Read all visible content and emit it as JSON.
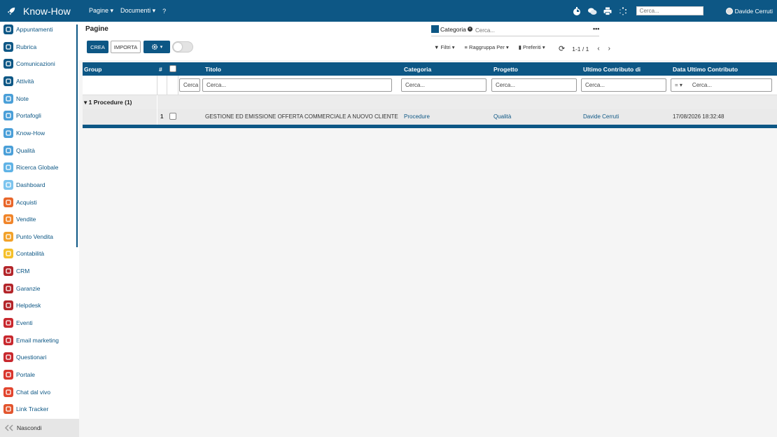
{
  "app": {
    "title": "Know-How"
  },
  "topmenu": [
    {
      "label": "Pagine ▾"
    },
    {
      "label": "Documenti ▾"
    },
    {
      "label": "?"
    }
  ],
  "top_search": {
    "placeholder": "Cerca..."
  },
  "user": {
    "name": "Davide Cerruti"
  },
  "sidebar": {
    "items": [
      {
        "label": "Appuntamenti",
        "color": "#0d5785",
        "icon": "calendar-icon"
      },
      {
        "label": "Rubrica",
        "color": "#0d5785",
        "icon": "address-book-icon"
      },
      {
        "label": "Comunicazioni",
        "color": "#0d5785",
        "icon": "chat-icon"
      },
      {
        "label": "Attività",
        "color": "#0d5785",
        "icon": "check-icon"
      },
      {
        "label": "Note",
        "color": "#4a9fd8",
        "icon": "note-icon"
      },
      {
        "label": "Portafogli",
        "color": "#4a9fd8",
        "icon": "briefcase-icon"
      },
      {
        "label": "Know-How",
        "color": "#4a9fd8",
        "icon": "bulb-icon"
      },
      {
        "label": "Qualità",
        "color": "#4a9fd8",
        "icon": "gear-icon"
      },
      {
        "label": "Ricerca Globale",
        "color": "#5fb3e6",
        "icon": "globe-icon"
      },
      {
        "label": "Dashboard",
        "color": "#7cc4ee",
        "icon": "dashboard-icon"
      },
      {
        "label": "Acquisti",
        "color": "#e8662a",
        "icon": "cart-icon"
      },
      {
        "label": "Vendite",
        "color": "#f0852a",
        "icon": "chart-icon"
      },
      {
        "label": "Punto Vendita",
        "color": "#f2a22a",
        "icon": "shop-icon"
      },
      {
        "label": "Contabilità",
        "color": "#f5c02a",
        "icon": "calculator-icon"
      },
      {
        "label": "CRM",
        "color": "#b3252a",
        "icon": "eye-icon"
      },
      {
        "label": "Garanzie",
        "color": "#b3252a",
        "icon": "shield-icon"
      },
      {
        "label": "Helpdesk",
        "color": "#b3252a",
        "icon": "headset-icon"
      },
      {
        "label": "Eventi",
        "color": "#c8282e",
        "icon": "ticket-icon"
      },
      {
        "label": "Email marketing",
        "color": "#c8282e",
        "icon": "send-icon"
      },
      {
        "label": "Questionari",
        "color": "#c8282e",
        "icon": "clipboard-icon"
      },
      {
        "label": "Portale",
        "color": "#d9362e",
        "icon": "portal-icon"
      },
      {
        "label": "Chat dal vivo",
        "color": "#e2452e",
        "icon": "bubble-icon"
      },
      {
        "label": "Link Tracker",
        "color": "#e2552e",
        "icon": "link-icon"
      }
    ],
    "hide_label": "Nascondi"
  },
  "control_panel": {
    "title": "Pagine",
    "create_label": "CREA",
    "import_label": "IMPORTA",
    "facet_label": "Categoria",
    "search_placeholder": "Cerca...",
    "more": "•••",
    "filters_label": "Filtri ▾",
    "groupby_label": "Raggruppa Per ▾",
    "favorites_label": "Preferiti ▾",
    "pager": "1-1 / 1"
  },
  "grid": {
    "headers": {
      "group": "Group",
      "num": "#",
      "title": "Titolo",
      "category": "Categoria",
      "project": "Progetto",
      "contributor": "Ultimo Contributo di",
      "date": "Data Ultimo Contributo"
    },
    "filters": {
      "narrow": "Cerca",
      "title": "Cerca...",
      "category": "Cerca...",
      "project": "Cerca...",
      "contributor": "Cerca...",
      "date_op": "= ▾",
      "date": "Cerca..."
    },
    "group_label": "▾ 1 Procedure (1)",
    "rows": [
      {
        "num": "1",
        "title": "GESTIONE ED EMISSIONE OFFERTA COMMERCIALE A NUOVO CLIENTE",
        "category": "Procedure",
        "project": "Qualità",
        "contributor": "Davide Cerruti",
        "date": "17/08/2026 18:32:48"
      }
    ]
  }
}
